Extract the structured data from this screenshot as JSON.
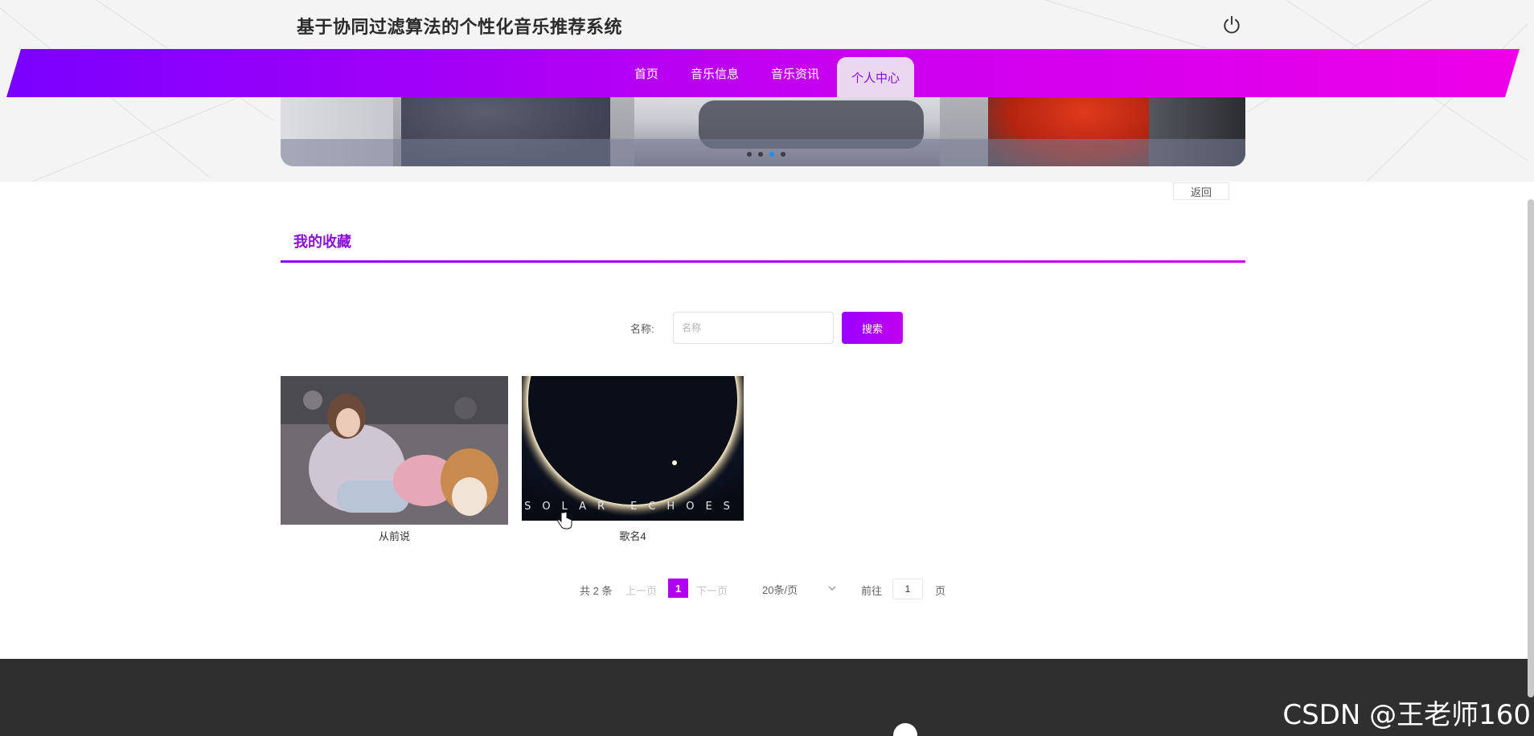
{
  "app": {
    "title": "基于协同过滤算法的个性化音乐推荐系统"
  },
  "icons": {
    "power": "power-icon",
    "chevron": "chevron-down-icon",
    "cursor": "hand-cursor-icon"
  },
  "nav": {
    "items": [
      {
        "label": "首页",
        "active": false
      },
      {
        "label": "音乐信息",
        "active": false
      },
      {
        "label": "音乐资讯",
        "active": false
      },
      {
        "label": "个人中心",
        "active": true
      }
    ]
  },
  "back_label": "返回",
  "section": {
    "title": "我的收藏"
  },
  "search": {
    "label": "名称:",
    "placeholder": "名称",
    "value": "",
    "button": "搜索"
  },
  "favorites": [
    {
      "name": "从前说"
    },
    {
      "name": "歌名4",
      "cover_text": "SOLAR ECHOES"
    }
  ],
  "pagination": {
    "total": "共 2 条",
    "prev": "上一页",
    "current": "1",
    "next": "下一页",
    "page_size": "20条/页",
    "goto": "前往",
    "goto_value": "1",
    "suffix": "页"
  },
  "watermark": "CSDN @王老师160",
  "colors": {
    "accent": "#b000f0",
    "nav_gradient_start": "#7a00ff",
    "nav_gradient_end": "#ee00e8",
    "footer": "#2f2f2f"
  }
}
